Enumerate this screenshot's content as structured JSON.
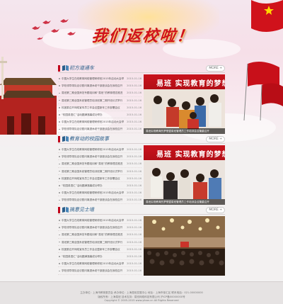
{
  "hero": {
    "title": "我们返校啦！"
  },
  "sections": [
    {
      "title": "初方道通车",
      "more": "MORE +",
      "photo_banner": "易班  实现教育的梦想",
      "photo_caption": "易班实现教育的梦想暨易班管理员工作培训会议隆重召开",
      "items": [
        {
          "t": "中国大学生在线教育网络管理研修班2015年启动大会举行",
          "d": "2015-01-16"
        },
        {
          "t": "学校领导带队走访慰问离退休老干部座谈会在我校召开",
          "d": "2015-01-16"
        },
        {
          "t": "易班第二期全国师范专题培训和“易班”的教育理念推进",
          "d": "2015-01-16"
        },
        {
          "t": "易班第三期全国系统管理员培训班第二期开班仪式举行",
          "d": "2015-01-16"
        },
        {
          "t": "校团委召开网络宣传员工作会议暨新年工作部署会议",
          "d": "2015-01-16"
        },
        {
          "t": "“校园英语汇”活动圆满落幕成功举办",
          "d": "2015-01-16"
        },
        {
          "t": "中国大学生在线教育网络管理研修班2015年启动大会举行",
          "d": "2015-01-16"
        },
        {
          "t": "学校领导带队走访慰问离退休老干部座谈会在我校召开",
          "d": "2015-01-16"
        }
      ]
    },
    {
      "title": "教育动的校园故事",
      "more": "MORE +",
      "photo_banner": "易班  实现教育的梦想",
      "photo_caption": "易班实现教育的梦想暨易班管理员工作培训会议隆重召开",
      "items": [
        {
          "t": "中国大学生在线教育网络管理研修班2015年启动大会举行",
          "d": "2015-01-16"
        },
        {
          "t": "学校领导带队走访慰问离退休老干部座谈会在我校召开",
          "d": "2015-01-16"
        },
        {
          "t": "易班第二期全国师范专题培训和“易班”的教育理念推进",
          "d": "2015-01-16"
        },
        {
          "t": "易班第三期全国系统管理员培训班第二期开班仪式举行",
          "d": "2015-01-16"
        },
        {
          "t": "校团委召开网络宣传员工作会议暨新年工作部署会议",
          "d": "2015-01-16"
        },
        {
          "t": "“校园英语汇”活动圆满落幕成功举办",
          "d": "2015-01-16"
        },
        {
          "t": "中国大学生在线教育网络管理研修班2015年启动大会举行",
          "d": "2015-01-16"
        },
        {
          "t": "学校领导带队走访慰问离退休老干部座谈会在我校召开",
          "d": "2015-01-16"
        }
      ]
    },
    {
      "title": "搞意见士墙",
      "more": "MORE +",
      "photo_banner": "",
      "photo_caption": "",
      "items": [
        {
          "t": "中国大学生在线教育网络管理研修班2015年启动大会举行",
          "d": "2015-01-16"
        },
        {
          "t": "学校领导带队走访慰问离退休老干部座谈会在我校召开",
          "d": "2015-01-16"
        },
        {
          "t": "易班第二期全国师范专题培训和“易班”的教育理念推进",
          "d": "2015-01-16"
        },
        {
          "t": "易班第三期全国系统管理员培训班第二期开班仪式举行",
          "d": "2015-01-16"
        },
        {
          "t": "校团委召开网络宣传员工作会议暨新年工作部署会议",
          "d": "2015-01-16"
        },
        {
          "t": "“校园英语汇”活动圆满落幕成功举办",
          "d": "2015-01-16"
        },
        {
          "t": "中国大学生在线教育网络管理研修班2015年启动大会举行",
          "d": "2015-01-16"
        },
        {
          "t": "学校领导带队走访慰问离退休老干部座谈会在我校召开",
          "d": "2015-01-16"
        }
      ]
    }
  ],
  "footer": {
    "line1": "主办单位：上海市教育委员会  承办单位：上海易班发展中心  地址：上海市徐汇区  联系电话：021-00000000",
    "line2": "版权所有：上海易班  技术支持：易班网络科技有限公司  沪ICP备00000000号",
    "line3": "Copyright © 2005-2015 www.yiban.cn All Rights Reserved"
  }
}
